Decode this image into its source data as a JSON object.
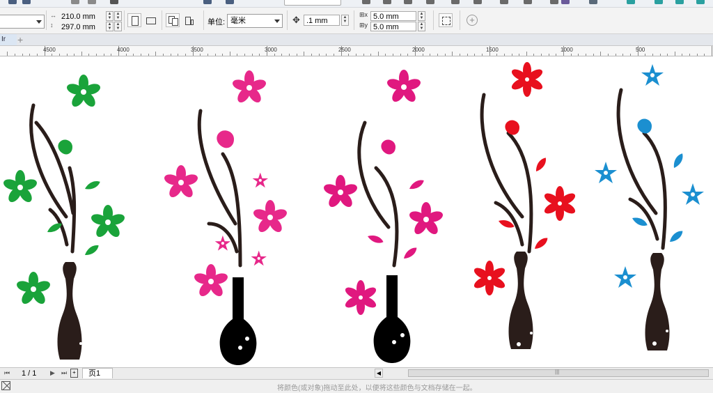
{
  "paper": {
    "width": "210.0 mm",
    "height": "297.0 mm"
  },
  "units": {
    "label": "单位:",
    "value": "毫米"
  },
  "nudge": {
    "value": ".1 mm"
  },
  "duplicate": {
    "x": "5.0 mm",
    "y": "5.0 mm"
  },
  "doc_tab": {
    "label": "Ir"
  },
  "ruler": {
    "labels": [
      "4500",
      "4000",
      "3500",
      "3000",
      "2500",
      "2000",
      "1500",
      "1000",
      "500"
    ]
  },
  "pages": {
    "counter": "1 / 1",
    "tab_label": "页1"
  },
  "status": {
    "hint": "将颜色(或对象)拖动至此处，以便将这些颜色与文档存储在一起。"
  },
  "colors": {
    "green": "#1aa33a",
    "pink": "#e7288a",
    "magenta": "#e0187f",
    "red": "#e8101e",
    "blue": "#1b8fd0",
    "stem": "#2a1d1a",
    "black": "#000000"
  },
  "icons": {
    "portrait": "portrait-page-icon",
    "landscape": "landscape-page-icon",
    "all_pages": "all-pages-icon",
    "current_page": "current-page-icon",
    "nudge": "nudge-arrows-icon",
    "dup_x": "duplicate-x-icon",
    "dup_y": "duplicate-y-icon",
    "snap": "snap-icon",
    "add": "add-circle-icon"
  }
}
